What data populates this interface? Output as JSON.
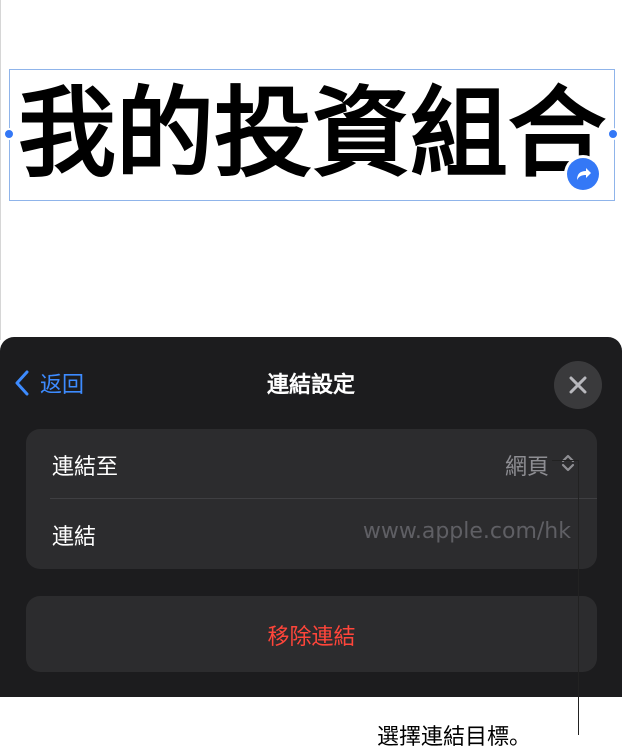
{
  "canvas": {
    "title_text": "我的投資組合"
  },
  "sheet": {
    "back_label": "返回",
    "title": "連結設定",
    "rows": [
      {
        "label": "連結至",
        "value": "網頁"
      },
      {
        "label": "連結",
        "value": "www.apple.com/hk"
      }
    ],
    "remove_label": "移除連結"
  },
  "callout": {
    "text": "選擇連結目標。"
  },
  "icons": {
    "back": "chevron-left-icon",
    "close": "close-icon",
    "link_badge": "link-arrow-icon",
    "picker": "chevron-up-down-icon"
  },
  "colors": {
    "accent": "#3478f6",
    "destructive": "#ff453a",
    "sheet_background": "#1c1c1e",
    "group_background": "#2c2c2e"
  }
}
